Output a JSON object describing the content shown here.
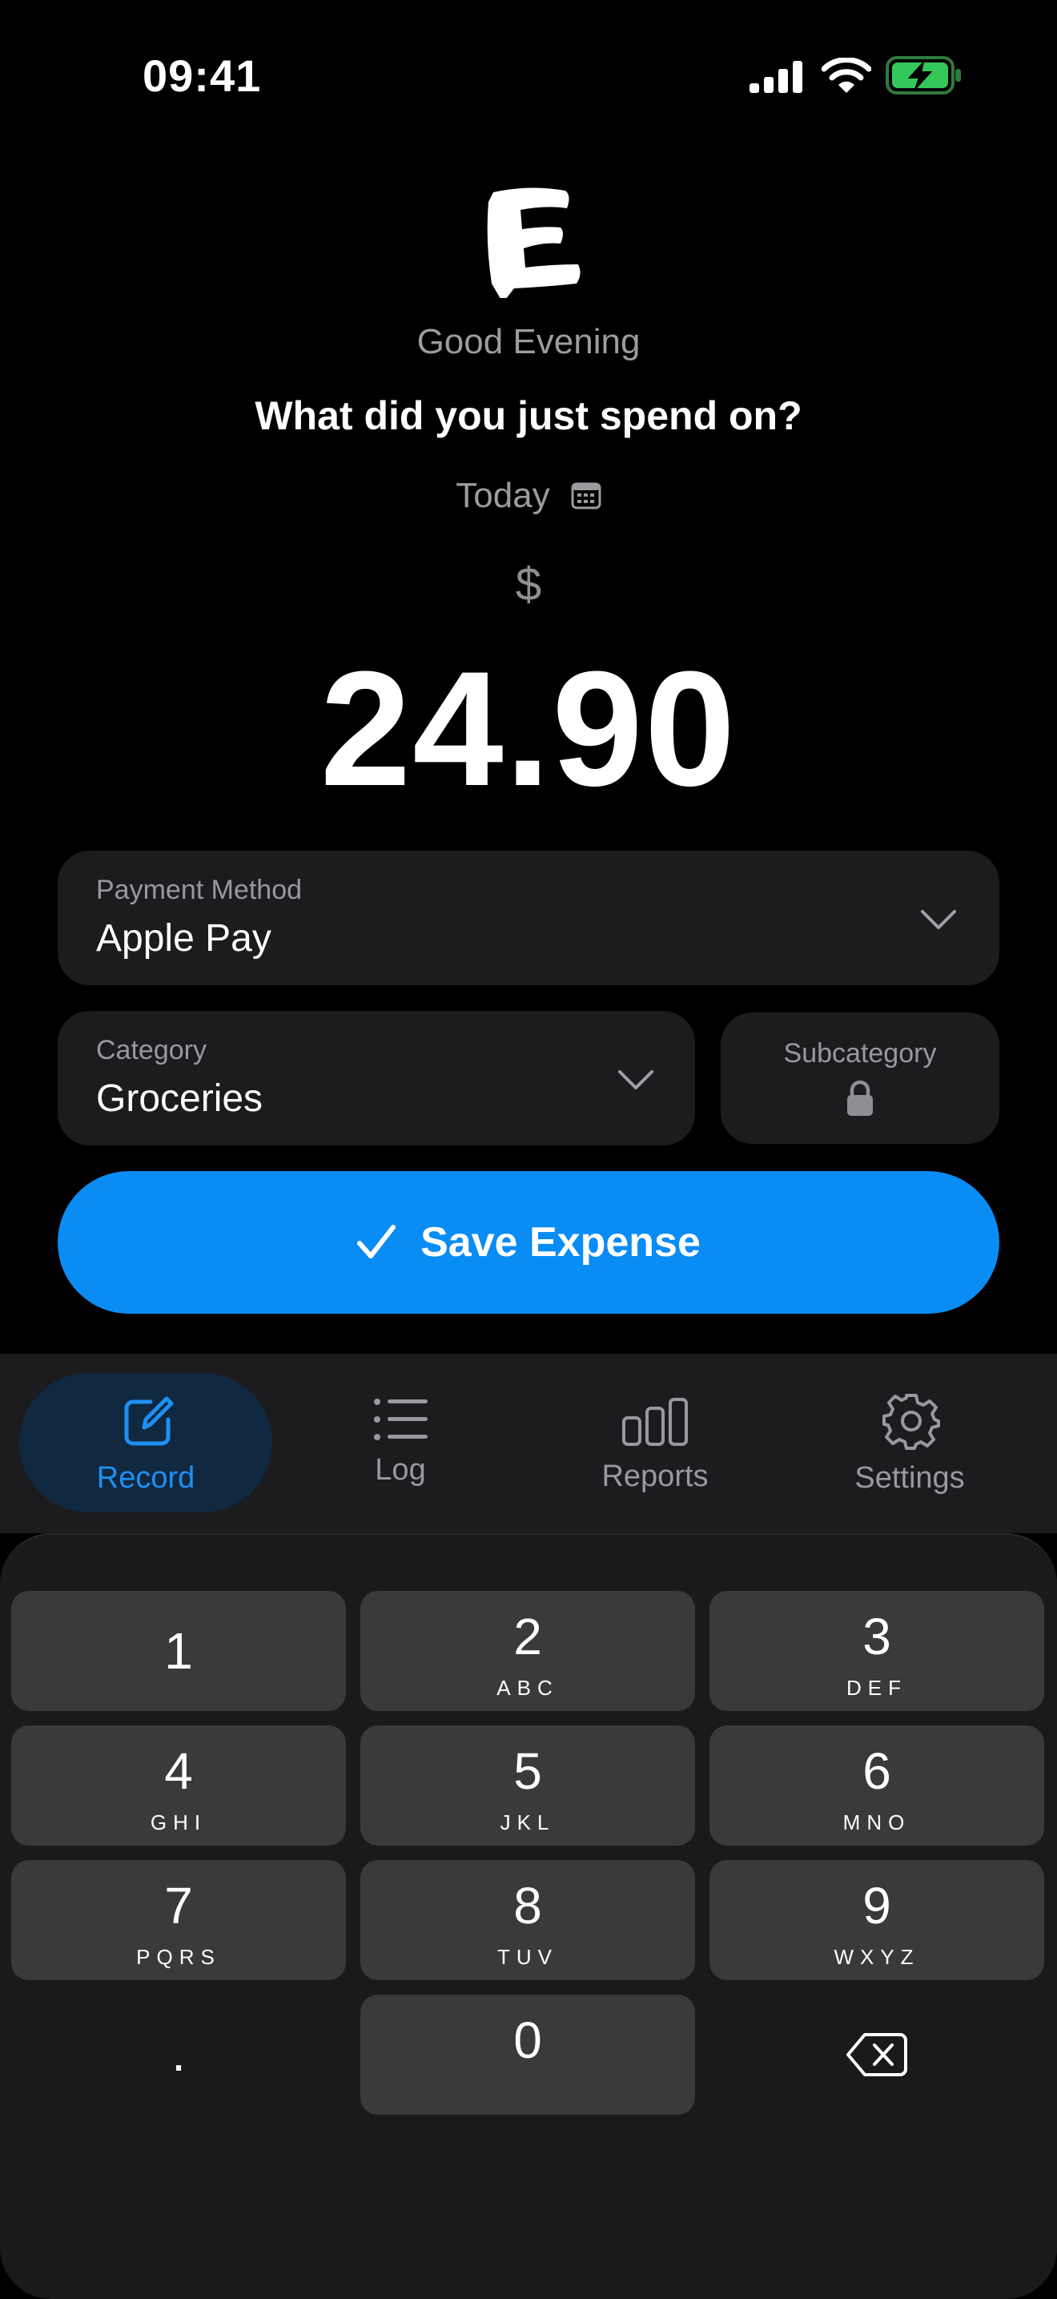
{
  "status_bar": {
    "time": "09:41",
    "icons": [
      "cellular-signal-icon",
      "wifi-icon",
      "battery-charging-icon"
    ]
  },
  "header": {
    "logo": "E",
    "greeting": "Good Evening",
    "question": "What did you just spend on?",
    "date_label": "Today",
    "date_icon": "calendar-icon",
    "currency_symbol": "$",
    "amount": "24.90"
  },
  "form": {
    "payment_method": {
      "label": "Payment Method",
      "value": "Apple Pay"
    },
    "category": {
      "label": "Category",
      "value": "Groceries"
    },
    "subcategory": {
      "label": "Subcategory",
      "locked": true
    },
    "save_button": {
      "label": "Save Expense",
      "icon": "checkmark-icon"
    }
  },
  "tabs": [
    {
      "label": "Record",
      "icon": "compose-icon",
      "active": true
    },
    {
      "label": "Log",
      "icon": "list-icon",
      "active": false
    },
    {
      "label": "Reports",
      "icon": "bar-chart-icon",
      "active": false
    },
    {
      "label": "Settings",
      "icon": "gear-icon",
      "active": false
    }
  ],
  "keypad": {
    "keys": [
      {
        "digit": "1",
        "letters": ""
      },
      {
        "digit": "2",
        "letters": "ABC"
      },
      {
        "digit": "3",
        "letters": "DEF"
      },
      {
        "digit": "4",
        "letters": "GHI"
      },
      {
        "digit": "5",
        "letters": "JKL"
      },
      {
        "digit": "6",
        "letters": "MNO"
      },
      {
        "digit": "7",
        "letters": "PQRS"
      },
      {
        "digit": "8",
        "letters": "TUV"
      },
      {
        "digit": "9",
        "letters": "WXYZ"
      },
      {
        "digit": "0",
        "letters": ""
      }
    ],
    "decimal": ".",
    "delete_icon": "backspace-icon"
  },
  "colors": {
    "background": "#000000",
    "card": "#1c1c1e",
    "accent": "#0a8cf5",
    "active_tab_bg": "#102840",
    "battery_green": "#34c759"
  }
}
